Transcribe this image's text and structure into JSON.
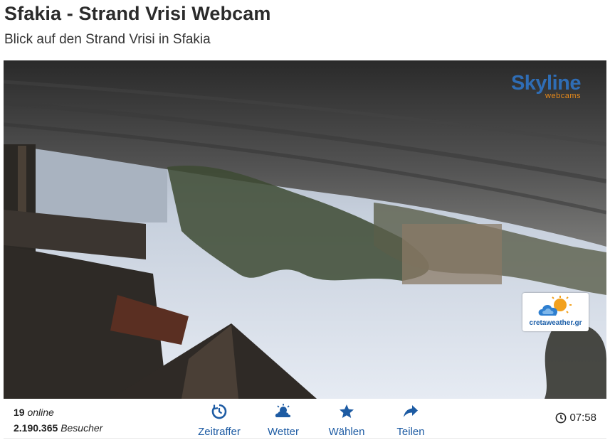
{
  "page": {
    "title": "Sfakia - Strand Vrisi Webcam",
    "subtitle": "Blick auf den Strand Vrisi in Sfakia"
  },
  "player": {
    "brand_logo": {
      "name": "Skyline",
      "tagline": "webcams"
    },
    "partner_logo": {
      "text": "cretaweather.gr",
      "icon": "sun-cloud-logo"
    }
  },
  "stats": {
    "online_count": "19",
    "online_label": "online",
    "visitors_count": "2.190.365",
    "visitors_label": "Besucher"
  },
  "actions": [
    {
      "label": "Zeitraffer",
      "icon": "timelapse-icon"
    },
    {
      "label": "Wetter",
      "icon": "weather-icon"
    },
    {
      "label": "Wählen",
      "icon": "star-icon"
    },
    {
      "label": "Teilen",
      "icon": "share-icon"
    }
  ],
  "time": {
    "value": "07:58",
    "icon": "clock-icon"
  },
  "colors": {
    "accent": "#1d5ba3",
    "brand_blue": "#2f6db5",
    "brand_orange": "#e88a1a"
  }
}
